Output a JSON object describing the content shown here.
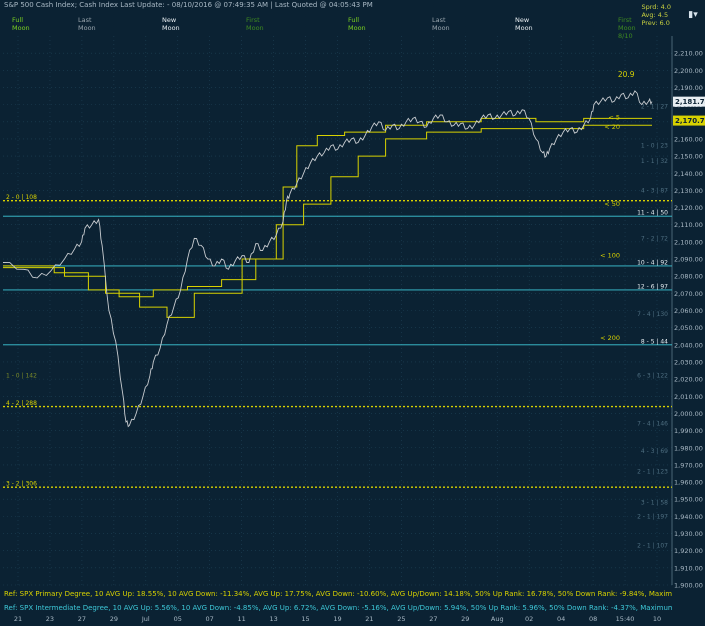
{
  "header": {
    "text": "S&P 500 Cash Index;  Cash Index  Last Update:  - 08/10/2016 @ 07:49:35 AM | Last Quoted @ 04:05:43 PM"
  },
  "stats_box": {
    "lines": [
      "Sprd: 4.0",
      "Avg: 4.5",
      "Prev: 6.0"
    ]
  },
  "menu_icon": "menu-dropdown-icon",
  "moon_labels": [
    {
      "l1": "Full",
      "l2": "Moon",
      "color": "#7ad020"
    },
    {
      "l1": "Last",
      "l2": "Moon",
      "color": "#9aa6ae"
    },
    {
      "l1": "New",
      "l2": "Moon",
      "color": "#e8eef2"
    },
    {
      "l1": "First",
      "l2": "Moon",
      "color": "#3e8a20"
    },
    {
      "l1": "Full",
      "l2": "Moon",
      "color": "#7ad020"
    },
    {
      "l1": "Last",
      "l2": "Moon",
      "color": "#9aa6ae"
    },
    {
      "l1": "New",
      "l2": "Moon",
      "color": "#e8eef2"
    },
    {
      "l1": "First",
      "l2": "Moon",
      "l3": "8/10",
      "color": "#3e8a20"
    }
  ],
  "footer": {
    "ref_primary": "Ref: SPX Primary Degree, 10 AVG Up: 18.55%, 10 AVG Down: -11.34%, AVG Up: 17.75%, AVG Down: -10.60%, AVG Up/Down: 14.18%, 50%  Up Rank: 16.78%, 50% Down Rank: -9.84%, Maximum Up: 32.34%, Maximum",
    "ref_intermediate": "Ref: SPX Intermediate Degree, 10 AVG Up: 5.56%, 10 AVG Down: -4.85%, AVG Up: 6.72%, AVG Down: -5.16%, AVG Up/Down: 5.94%, 50%  Up Rank: 5.96%, 50% Down Rank: -4.37%, Maximum Up: 20.27%, Maximum Dc"
  },
  "colors": {
    "background": "#0b2233",
    "price": "#c8ccd0",
    "yellow": "#d8d200",
    "cyan": "#3ec8d8",
    "grid": "#1e4156"
  },
  "chart_data": {
    "type": "line",
    "title": "",
    "ylim": [
      1900,
      2220
    ],
    "y_ticks": [
      "2,210.00",
      "2,200.00",
      "2,190.00",
      "2,180.00",
      "2,170.00",
      "2,160.00",
      "2,150.00",
      "2,140.00",
      "2,130.00",
      "2,120.00",
      "2,110.00",
      "2,100.00",
      "2,090.00",
      "2,080.00",
      "2,070.00",
      "2,060.00",
      "2,050.00",
      "2,040.00",
      "2,030.00",
      "2,020.00",
      "2,010.00",
      "2,000.00",
      "1,990.00",
      "1,980.00",
      "1,970.00",
      "1,960.00",
      "1,950.00",
      "1,940.00",
      "1,930.00",
      "1,920.00",
      "1,910.00",
      "1,900.00"
    ],
    "x_ticks": [
      "21",
      "23",
      "27",
      "29",
      "Jul",
      "05",
      "07",
      "11",
      "13",
      "15",
      "19",
      "21",
      "25",
      "27",
      "29",
      "Aug",
      "02",
      "04",
      "08",
      "15:40",
      "10"
    ],
    "price_series": {
      "name": "SPX",
      "points": [
        [
          0,
          2088
        ],
        [
          6,
          2084
        ],
        [
          10,
          2079
        ],
        [
          14,
          2083
        ],
        [
          18,
          2090
        ],
        [
          21,
          2096
        ],
        [
          23,
          2100
        ],
        [
          24,
          2108
        ],
        [
          26,
          2110
        ],
        [
          28,
          2113
        ],
        [
          29,
          2098
        ],
        [
          31,
          2060
        ],
        [
          33,
          2042
        ],
        [
          35,
          2012
        ],
        [
          36,
          1995
        ],
        [
          37,
          1993
        ],
        [
          39,
          2000
        ],
        [
          41,
          2010
        ],
        [
          43,
          2022
        ],
        [
          44,
          2030
        ],
        [
          46,
          2038
        ],
        [
          48,
          2052
        ],
        [
          50,
          2062
        ],
        [
          52,
          2072
        ],
        [
          54,
          2090
        ],
        [
          56,
          2102
        ],
        [
          58,
          2098
        ],
        [
          60,
          2090
        ],
        [
          62,
          2086
        ],
        [
          64,
          2090
        ],
        [
          66,
          2084
        ],
        [
          68,
          2089
        ],
        [
          70,
          2092
        ],
        [
          72,
          2088
        ],
        [
          74,
          2099
        ],
        [
          76,
          2095
        ],
        [
          78,
          2100
        ],
        [
          80,
          2104
        ],
        [
          82,
          2112
        ],
        [
          83,
          2124
        ],
        [
          84,
          2128
        ],
        [
          86,
          2134
        ],
        [
          88,
          2140
        ],
        [
          90,
          2146
        ],
        [
          92,
          2150
        ],
        [
          94,
          2152
        ],
        [
          96,
          2156
        ],
        [
          98,
          2154
        ],
        [
          100,
          2158
        ],
        [
          102,
          2160
        ],
        [
          104,
          2158
        ],
        [
          106,
          2162
        ],
        [
          108,
          2167
        ],
        [
          110,
          2170
        ],
        [
          112,
          2165
        ],
        [
          114,
          2168
        ],
        [
          116,
          2166
        ],
        [
          118,
          2170
        ],
        [
          120,
          2172
        ],
        [
          122,
          2170
        ],
        [
          124,
          2167
        ],
        [
          126,
          2172
        ],
        [
          128,
          2174
        ],
        [
          130,
          2170
        ],
        [
          132,
          2168
        ],
        [
          134,
          2169
        ],
        [
          136,
          2166
        ],
        [
          138,
          2168
        ],
        [
          140,
          2172
        ],
        [
          142,
          2174
        ],
        [
          144,
          2172
        ],
        [
          146,
          2174
        ],
        [
          148,
          2176
        ],
        [
          150,
          2174
        ],
        [
          152,
          2177
        ],
        [
          154,
          2172
        ],
        [
          156,
          2160
        ],
        [
          158,
          2152
        ],
        [
          159,
          2150
        ],
        [
          160,
          2154
        ],
        [
          162,
          2160
        ],
        [
          164,
          2164
        ],
        [
          166,
          2166
        ],
        [
          168,
          2164
        ],
        [
          170,
          2168
        ],
        [
          172,
          2172
        ],
        [
          173,
          2180
        ],
        [
          175,
          2182
        ],
        [
          177,
          2184
        ],
        [
          179,
          2182
        ],
        [
          181,
          2186
        ],
        [
          183,
          2184
        ],
        [
          185,
          2188
        ],
        [
          187,
          2180
        ],
        [
          189,
          2182
        ],
        [
          190,
          2181.74
        ]
      ],
      "last": "2,181.74"
    },
    "series": [
      {
        "name": "< 5",
        "points": [
          [
            0,
            2086
          ],
          [
            15,
            2086
          ],
          [
            15,
            2082
          ],
          [
            25,
            2082
          ],
          [
            25,
            2072
          ],
          [
            34,
            2072
          ],
          [
            34,
            2068
          ],
          [
            44,
            2068
          ],
          [
            44,
            2072
          ],
          [
            54,
            2072
          ],
          [
            54,
            2074
          ],
          [
            64,
            2074
          ],
          [
            64,
            2078
          ],
          [
            74,
            2078
          ],
          [
            74,
            2090
          ],
          [
            82,
            2090
          ],
          [
            82,
            2132
          ],
          [
            86,
            2132
          ],
          [
            86,
            2156
          ],
          [
            92,
            2156
          ],
          [
            92,
            2162
          ],
          [
            100,
            2162
          ],
          [
            100,
            2164
          ],
          [
            112,
            2164
          ],
          [
            112,
            2168
          ],
          [
            124,
            2168
          ],
          [
            124,
            2170
          ],
          [
            140,
            2170
          ],
          [
            140,
            2172
          ],
          [
            156,
            2172
          ],
          [
            156,
            2170
          ],
          [
            170,
            2170
          ],
          [
            170,
            2172
          ],
          [
            190,
            2172
          ]
        ],
        "label": "< 5",
        "label_y": 2172.5
      },
      {
        "name": "< 20",
        "points": [
          [
            0,
            2085
          ],
          [
            18,
            2085
          ],
          [
            18,
            2080
          ],
          [
            30,
            2080
          ],
          [
            30,
            2070
          ],
          [
            40,
            2070
          ],
          [
            40,
            2062
          ],
          [
            48,
            2062
          ],
          [
            48,
            2056
          ],
          [
            56,
            2056
          ],
          [
            56,
            2070
          ],
          [
            70,
            2070
          ],
          [
            70,
            2090
          ],
          [
            80,
            2090
          ],
          [
            80,
            2110
          ],
          [
            88,
            2110
          ],
          [
            88,
            2122
          ],
          [
            96,
            2122
          ],
          [
            96,
            2138
          ],
          [
            104,
            2138
          ],
          [
            104,
            2150
          ],
          [
            112,
            2150
          ],
          [
            112,
            2160
          ],
          [
            124,
            2160
          ],
          [
            124,
            2164
          ],
          [
            140,
            2164
          ],
          [
            140,
            2166
          ],
          [
            156,
            2166
          ],
          [
            156,
            2166
          ],
          [
            170,
            2166
          ],
          [
            170,
            2168
          ],
          [
            190,
            2168
          ]
        ],
        "label": "< 20",
        "label_y": 2167
      },
      {
        "name": "< 50",
        "label": "< 50",
        "label_y": 2122
      },
      {
        "name": "< 100",
        "label": "< 100",
        "label_y": 2092
      },
      {
        "name": "< 200",
        "label": "< 200",
        "label_y": 2044
      }
    ],
    "horizontal_levels": [
      {
        "value": 2124,
        "style": "yellow-dotted",
        "left_label": "2 - 0 | 108"
      },
      {
        "value": 2115,
        "style": "cyan",
        "right_label": "11 - 4 | 50"
      },
      {
        "value": 2086,
        "style": "cyan",
        "right_label": "10 - 4 | 92"
      },
      {
        "value": 2072,
        "style": "cyan",
        "right_label": "12 - 6 | 97"
      },
      {
        "value": 2040,
        "style": "cyan",
        "right_label": "8 - 5 | 44"
      },
      {
        "value": 2004,
        "style": "yellow-dotted",
        "left_label": "4 - 2 | 288"
      },
      {
        "value": 1957,
        "style": "yellow-dotted",
        "left_label": "3 - 2 | 306"
      },
      {
        "value": 2177,
        "style": "faint",
        "right_label": "2 - 1 | 27"
      },
      {
        "value": 2154,
        "style": "faint",
        "right_label": "1 - 0 | 23"
      },
      {
        "value": 2145,
        "style": "faint",
        "right_label": "1 - 1 | 32"
      },
      {
        "value": 2128,
        "style": "faint",
        "right_label": "4 - 3 | 87"
      },
      {
        "value": 2100,
        "style": "faint",
        "right_label": "7 - 2 | 72"
      },
      {
        "value": 2056,
        "style": "faint",
        "right_label": "7 - 4 | 130"
      },
      {
        "value": 2020,
        "style": "faint",
        "right_label": "6 - 3 | 122",
        "left_label": "1 - 0 | 142"
      },
      {
        "value": 1992,
        "style": "faint",
        "right_label": "7 - 4 | 146"
      },
      {
        "value": 1976,
        "style": "faint",
        "right_label": "4 - 3 | 69"
      },
      {
        "value": 1964,
        "style": "faint",
        "right_label": "2 - 1 | 123"
      },
      {
        "value": 1946,
        "style": "faint",
        "right_label": "3 - 1 | 58"
      },
      {
        "value": 1938,
        "style": "faint",
        "right_label": "2 - 1 | 197"
      },
      {
        "value": 1921,
        "style": "faint",
        "right_label": "2 - 1 | 107"
      }
    ],
    "annotations": [
      {
        "text": "20.9",
        "x": 180,
        "y": 2196,
        "color": "#d8d200"
      },
      {
        "text": "2,181.74",
        "kind": "last-price"
      },
      {
        "text": "2,170.7",
        "kind": "ma-price"
      }
    ]
  }
}
